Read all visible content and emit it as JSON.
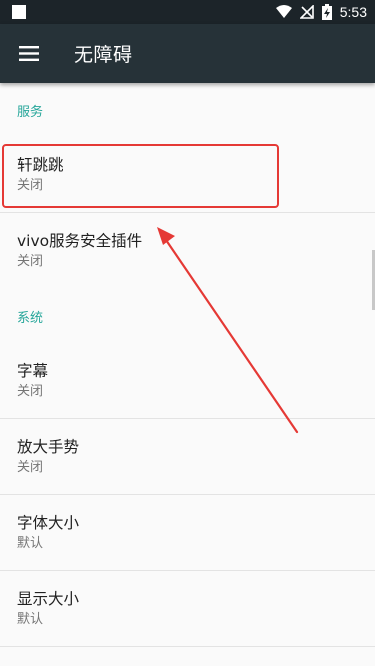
{
  "status_bar": {
    "time": "5:53"
  },
  "toolbar": {
    "title": "无障碍"
  },
  "sections": [
    {
      "header": "服务",
      "items": [
        {
          "title": "轩跳跳",
          "summary": "关闭"
        },
        {
          "title": "vivo服务安全插件",
          "summary": "关闭"
        }
      ]
    },
    {
      "header": "系统",
      "items": [
        {
          "title": "字幕",
          "summary": "关闭"
        },
        {
          "title": "放大手势",
          "summary": "关闭"
        },
        {
          "title": "字体大小",
          "summary": "默认"
        },
        {
          "title": "显示大小",
          "summary": "默认"
        }
      ]
    }
  ],
  "colors": {
    "accent": "#26a69a",
    "toolbar": "#263238",
    "annotation": "#e53935"
  }
}
